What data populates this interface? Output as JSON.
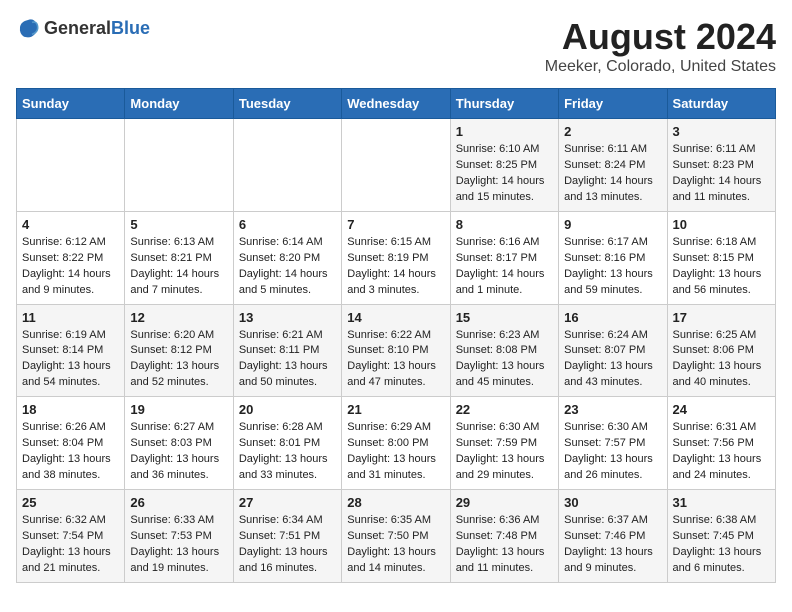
{
  "logo": {
    "general": "General",
    "blue": "Blue"
  },
  "title": "August 2024",
  "subtitle": "Meeker, Colorado, United States",
  "days_of_week": [
    "Sunday",
    "Monday",
    "Tuesday",
    "Wednesday",
    "Thursday",
    "Friday",
    "Saturday"
  ],
  "weeks": [
    [
      {
        "day": "",
        "sunrise": "",
        "sunset": "",
        "daylight": ""
      },
      {
        "day": "",
        "sunrise": "",
        "sunset": "",
        "daylight": ""
      },
      {
        "day": "",
        "sunrise": "",
        "sunset": "",
        "daylight": ""
      },
      {
        "day": "",
        "sunrise": "",
        "sunset": "",
        "daylight": ""
      },
      {
        "day": "1",
        "sunrise": "6:10 AM",
        "sunset": "8:25 PM",
        "daylight": "14 hours and 15 minutes."
      },
      {
        "day": "2",
        "sunrise": "6:11 AM",
        "sunset": "8:24 PM",
        "daylight": "14 hours and 13 minutes."
      },
      {
        "day": "3",
        "sunrise": "6:11 AM",
        "sunset": "8:23 PM",
        "daylight": "14 hours and 11 minutes."
      }
    ],
    [
      {
        "day": "4",
        "sunrise": "6:12 AM",
        "sunset": "8:22 PM",
        "daylight": "14 hours and 9 minutes."
      },
      {
        "day": "5",
        "sunrise": "6:13 AM",
        "sunset": "8:21 PM",
        "daylight": "14 hours and 7 minutes."
      },
      {
        "day": "6",
        "sunrise": "6:14 AM",
        "sunset": "8:20 PM",
        "daylight": "14 hours and 5 minutes."
      },
      {
        "day": "7",
        "sunrise": "6:15 AM",
        "sunset": "8:19 PM",
        "daylight": "14 hours and 3 minutes."
      },
      {
        "day": "8",
        "sunrise": "6:16 AM",
        "sunset": "8:17 PM",
        "daylight": "14 hours and 1 minute."
      },
      {
        "day": "9",
        "sunrise": "6:17 AM",
        "sunset": "8:16 PM",
        "daylight": "13 hours and 59 minutes."
      },
      {
        "day": "10",
        "sunrise": "6:18 AM",
        "sunset": "8:15 PM",
        "daylight": "13 hours and 56 minutes."
      }
    ],
    [
      {
        "day": "11",
        "sunrise": "6:19 AM",
        "sunset": "8:14 PM",
        "daylight": "13 hours and 54 minutes."
      },
      {
        "day": "12",
        "sunrise": "6:20 AM",
        "sunset": "8:12 PM",
        "daylight": "13 hours and 52 minutes."
      },
      {
        "day": "13",
        "sunrise": "6:21 AM",
        "sunset": "8:11 PM",
        "daylight": "13 hours and 50 minutes."
      },
      {
        "day": "14",
        "sunrise": "6:22 AM",
        "sunset": "8:10 PM",
        "daylight": "13 hours and 47 minutes."
      },
      {
        "day": "15",
        "sunrise": "6:23 AM",
        "sunset": "8:08 PM",
        "daylight": "13 hours and 45 minutes."
      },
      {
        "day": "16",
        "sunrise": "6:24 AM",
        "sunset": "8:07 PM",
        "daylight": "13 hours and 43 minutes."
      },
      {
        "day": "17",
        "sunrise": "6:25 AM",
        "sunset": "8:06 PM",
        "daylight": "13 hours and 40 minutes."
      }
    ],
    [
      {
        "day": "18",
        "sunrise": "6:26 AM",
        "sunset": "8:04 PM",
        "daylight": "13 hours and 38 minutes."
      },
      {
        "day": "19",
        "sunrise": "6:27 AM",
        "sunset": "8:03 PM",
        "daylight": "13 hours and 36 minutes."
      },
      {
        "day": "20",
        "sunrise": "6:28 AM",
        "sunset": "8:01 PM",
        "daylight": "13 hours and 33 minutes."
      },
      {
        "day": "21",
        "sunrise": "6:29 AM",
        "sunset": "8:00 PM",
        "daylight": "13 hours and 31 minutes."
      },
      {
        "day": "22",
        "sunrise": "6:30 AM",
        "sunset": "7:59 PM",
        "daylight": "13 hours and 29 minutes."
      },
      {
        "day": "23",
        "sunrise": "6:30 AM",
        "sunset": "7:57 PM",
        "daylight": "13 hours and 26 minutes."
      },
      {
        "day": "24",
        "sunrise": "6:31 AM",
        "sunset": "7:56 PM",
        "daylight": "13 hours and 24 minutes."
      }
    ],
    [
      {
        "day": "25",
        "sunrise": "6:32 AM",
        "sunset": "7:54 PM",
        "daylight": "13 hours and 21 minutes."
      },
      {
        "day": "26",
        "sunrise": "6:33 AM",
        "sunset": "7:53 PM",
        "daylight": "13 hours and 19 minutes."
      },
      {
        "day": "27",
        "sunrise": "6:34 AM",
        "sunset": "7:51 PM",
        "daylight": "13 hours and 16 minutes."
      },
      {
        "day": "28",
        "sunrise": "6:35 AM",
        "sunset": "7:50 PM",
        "daylight": "13 hours and 14 minutes."
      },
      {
        "day": "29",
        "sunrise": "6:36 AM",
        "sunset": "7:48 PM",
        "daylight": "13 hours and 11 minutes."
      },
      {
        "day": "30",
        "sunrise": "6:37 AM",
        "sunset": "7:46 PM",
        "daylight": "13 hours and 9 minutes."
      },
      {
        "day": "31",
        "sunrise": "6:38 AM",
        "sunset": "7:45 PM",
        "daylight": "13 hours and 6 minutes."
      }
    ]
  ],
  "labels": {
    "sunrise": "Sunrise:",
    "sunset": "Sunset:",
    "daylight": "Daylight:"
  },
  "accent_color": "#2a6db5"
}
